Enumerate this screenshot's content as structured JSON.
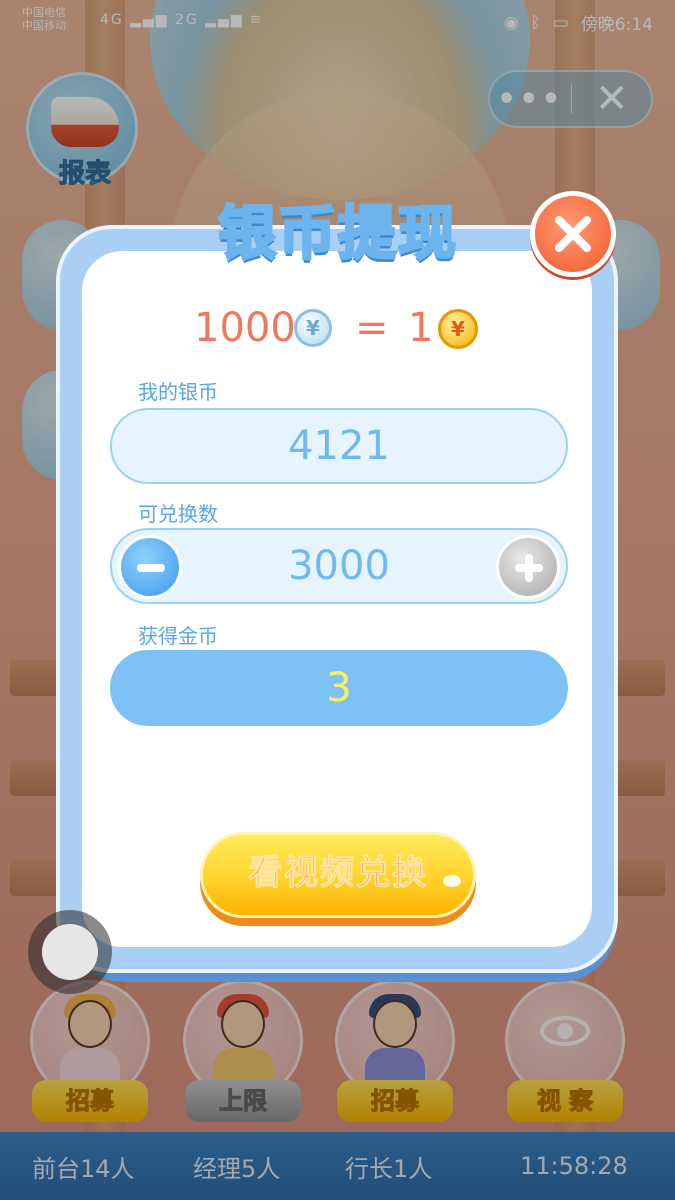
{
  "status_bar": {
    "carrier_line1": "中国电信",
    "carrier_line2": "中国移动",
    "network_1": "4G",
    "network_2": "2G",
    "time": "傍晚6:14"
  },
  "capsule": {
    "more_label": "•••",
    "close_label": "✕"
  },
  "report": {
    "label": "报表"
  },
  "dialog": {
    "title": "银币提现",
    "rate": {
      "silver_amount": "1000",
      "equals": "=",
      "gold_amount": "1",
      "silver_coin_symbol": "¥",
      "gold_coin_symbol": "¥"
    },
    "my_silver": {
      "label": "我的银币",
      "value": "4121"
    },
    "exchange_amount": {
      "label": "可兑换数",
      "value": "3000"
    },
    "gold_gained": {
      "label": "获得金币",
      "value": "3"
    },
    "action_button": "看视频兑换"
  },
  "bottom_characters": [
    {
      "tag": "招募"
    },
    {
      "tag": "上限"
    },
    {
      "tag": "招募"
    },
    {
      "tag": "视 察"
    }
  ],
  "bottom_bar": {
    "reception": "前台14人",
    "manager": "经理5人",
    "president": "行长1人",
    "clock": "11:58:28"
  },
  "colors": {
    "dialog_border": "#a9cff5",
    "accent_blue": "#6fb9ef",
    "rate_text": "#f0785a",
    "gold_value": "#ffef5e",
    "button_orange": "#ff7a1a",
    "close_red": "#f25a2e"
  }
}
